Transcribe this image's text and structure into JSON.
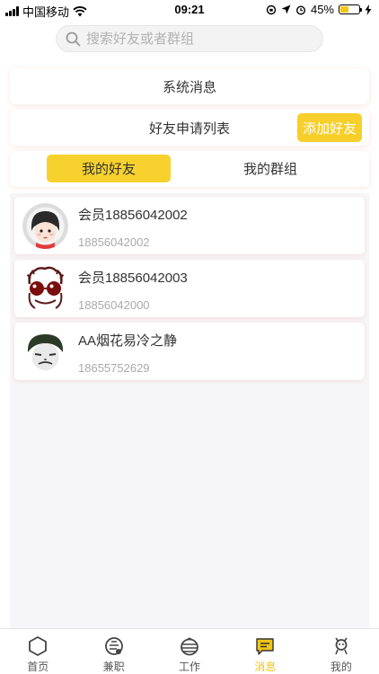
{
  "status_bar": {
    "carrier": "中国移动",
    "time": "09:21",
    "battery": "45%",
    "battery_level": 0.45
  },
  "search": {
    "placeholder": "搜索好友或者群组"
  },
  "system_messages": {
    "label": "系统消息"
  },
  "friend_requests": {
    "label": "好友申请列表",
    "add_button": "添加好友"
  },
  "tabs": [
    {
      "label": "我的好友",
      "active": true
    },
    {
      "label": "我的群组",
      "active": false
    }
  ],
  "friends": [
    {
      "name": "会员18856042002",
      "id": "18856042002",
      "avatar": "girl-avatar"
    },
    {
      "name": "会员18856042003",
      "id": "18856042000",
      "avatar": "glasses-avatar"
    },
    {
      "name": "AA烟花易冷之静",
      "id": "18655752629",
      "avatar": "meme-avatar"
    }
  ],
  "bottom_nav": [
    {
      "label": "首页",
      "icon": "home-hexagon-icon",
      "active": false
    },
    {
      "label": "兼职",
      "icon": "parttime-icon",
      "active": false
    },
    {
      "label": "工作",
      "icon": "work-icon",
      "active": false
    },
    {
      "label": "消息",
      "icon": "message-icon",
      "active": true
    },
    {
      "label": "我的",
      "icon": "profile-robot-icon",
      "active": false
    }
  ],
  "colors": {
    "accent": "#f7d22e",
    "button": "#f7cf2b",
    "nav_active": "#f0c419"
  }
}
